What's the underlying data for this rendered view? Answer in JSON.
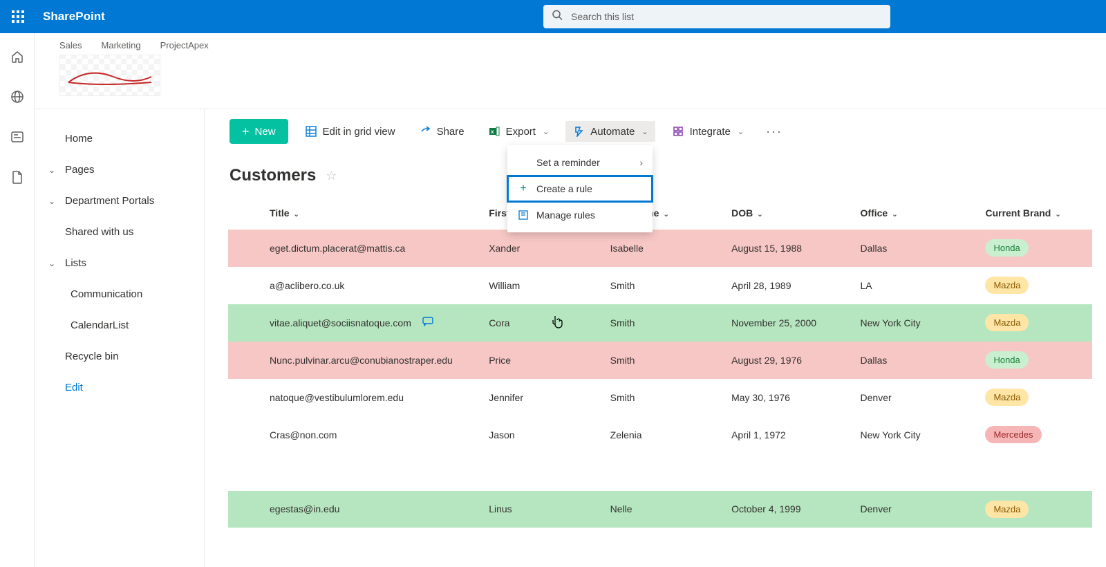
{
  "suite": {
    "appTitle": "SharePoint",
    "searchPlaceholder": "Search this list"
  },
  "siteNav": {
    "crumbs": [
      "Sales",
      "Marketing",
      "ProjectApex"
    ]
  },
  "leftNav": {
    "home": "Home",
    "pages": "Pages",
    "dept": "Department Portals",
    "shared": "Shared with us",
    "lists": "Lists",
    "comm": "Communication",
    "cal": "CalendarList",
    "recycle": "Recycle bin",
    "edit": "Edit"
  },
  "cmd": {
    "new": "New",
    "editGrid": "Edit in grid view",
    "share": "Share",
    "export": "Export",
    "automate": "Automate",
    "integrate": "Integrate"
  },
  "automateMenu": {
    "reminder": "Set a reminder",
    "createRule": "Create a rule",
    "manageRules": "Manage rules"
  },
  "listTitle": "Customers",
  "columns": {
    "title": "Title",
    "first": "First Name",
    "last": "Last Name",
    "dob": "DOB",
    "office": "Office",
    "brand": "Current Brand"
  },
  "rows": [
    {
      "title": "eget.dictum.placerat@mattis.ca",
      "first": "Xander",
      "last": "Isabelle",
      "dob": "August 15, 1988",
      "office": "Dallas",
      "brand": "Honda",
      "rowClass": "pink",
      "comment": false
    },
    {
      "title": "a@aclibero.co.uk",
      "first": "William",
      "last": "Smith",
      "dob": "April 28, 1989",
      "office": "LA",
      "brand": "Mazda",
      "rowClass": "",
      "comment": false
    },
    {
      "title": "vitae.aliquet@sociisnatoque.com",
      "first": "Cora",
      "last": "Smith",
      "dob": "November 25, 2000",
      "office": "New York City",
      "brand": "Mazda",
      "rowClass": "green",
      "comment": true
    },
    {
      "title": "Nunc.pulvinar.arcu@conubianostraper.edu",
      "first": "Price",
      "last": "Smith",
      "dob": "August 29, 1976",
      "office": "Dallas",
      "brand": "Honda",
      "rowClass": "pink",
      "comment": false
    },
    {
      "title": "natoque@vestibulumlorem.edu",
      "first": "Jennifer",
      "last": "Smith",
      "dob": "May 30, 1976",
      "office": "Denver",
      "brand": "Mazda",
      "rowClass": "",
      "comment": false
    },
    {
      "title": "Cras@non.com",
      "first": "Jason",
      "last": "Zelenia",
      "dob": "April 1, 1972",
      "office": "New York City",
      "brand": "Mercedes",
      "rowClass": "",
      "comment": false
    },
    {
      "title": "egestas@in.edu",
      "first": "Linus",
      "last": "Nelle",
      "dob": "October 4, 1999",
      "office": "Denver",
      "brand": "Mazda",
      "rowClass": "green",
      "comment": false
    }
  ]
}
